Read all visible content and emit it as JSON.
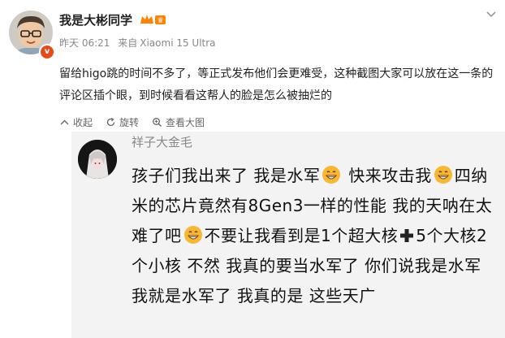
{
  "post": {
    "username": "我是大彬同学",
    "time": "昨天 06:21",
    "source_prefix": "来自",
    "device": "Xiaomi 15 Ultra",
    "text": "留给higo跳的时间不多了，等正式发布他们会更难受，这种截图大家可以放在这一条的评论区插个眼，到时候看看这帮人的脸是怎么被抽烂的",
    "actions": [
      {
        "label": "收起",
        "icon": "collapse-icon"
      },
      {
        "label": "旋转",
        "icon": "rotate-icon"
      },
      {
        "label": "查看大图",
        "icon": "zoom-icon"
      }
    ]
  },
  "comment": {
    "name": "祥子大金毛",
    "segments": [
      "孩子们我出来了 我是水军",
      "快来攻击我",
      "四纳米的芯片竟然有8Gen3一样的性能 我的天呐在太难了吧",
      "不要让我看到是1个超大核",
      "5个大核2个小核 不然 我真的要当水军了 你们说我是水军我就是水军了 我真的是 这些天广"
    ]
  },
  "colors": {
    "accent_orange": "#ff8200",
    "meta_gray": "#888888",
    "badge_red": "#e64a19",
    "emoji_yellow": "#f7b731"
  }
}
